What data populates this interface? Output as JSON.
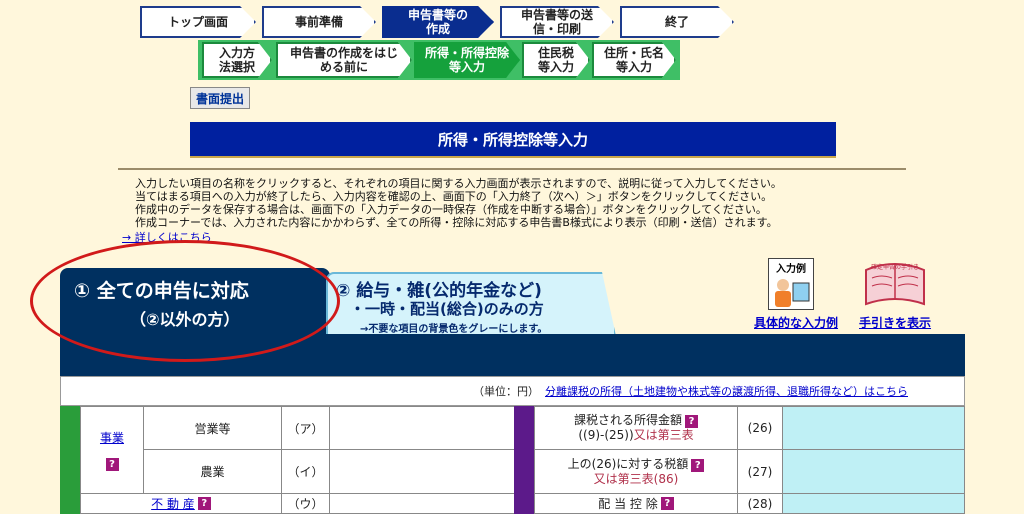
{
  "steps": [
    "トップ画面",
    "事前準備",
    "申告書等の作成",
    "申告書等の送信・印刷",
    "終了"
  ],
  "substeps": [
    "入力方法選択",
    "申告書の作成をはじめる前に",
    "所得・所得控除等入力",
    "住民税等入力",
    "住所・氏名等入力"
  ],
  "submit_button": "書面提出",
  "page_title": "所得・所得控除等入力",
  "instructions": [
    "入力したい項目の名称をクリックすると、それぞれの項目に関する入力画面が表示されますので、説明に従って入力してください。",
    "当てはまる項目への入力が終了したら、入力内容を確認の上、画面下の「入力終了（次へ）＞」ボタンをクリックしてください。",
    "作成中のデータを保存する場合は、画面下の「入力データの一時保存（作成を中断する場合）」ボタンをクリックしてください。",
    "作成コーナーでは、入力された内容にかかわらず、全ての所得・控除に対応する申告書B様式により表示（印刷・送信）されます。"
  ],
  "details_link": "→ 詳しくはこちら",
  "tab1": {
    "line1": "① 全ての申告に対応",
    "line2": "（②以外の方）"
  },
  "tab2": {
    "line1": "② 給与・雑(公的年金など)",
    "line2": "・一時・配当(総合)のみの方",
    "note": "→不要な項目の背景色をグレーにします。"
  },
  "example_icon_label": "入力例",
  "example_link": "具体的な入力例",
  "guide_link": "手引きを表示",
  "guide_icon_text": "確定申告の手引き",
  "unit": "（単位：円）",
  "separate_tax_link": "分離課税の所得（土地建物や株式等の譲渡所得、退職所得など）はこちら",
  "help_mark": "?",
  "left_table": {
    "group_label": "事業",
    "rows": [
      {
        "label": "営業等",
        "code": "（ア）"
      },
      {
        "label": "農業",
        "code": "（イ）"
      }
    ],
    "last_label": "不 動 産",
    "last_code": "（ウ）"
  },
  "right_table": {
    "rows": [
      {
        "label1": "課税される所得金額",
        "label2": "((9)-(25))",
        "label2b": "又は第三表",
        "code": "(26)"
      },
      {
        "label1": "上の(26)に対する税額",
        "label2": "",
        "label2b": "又は第三表(86)",
        "code": "(27)"
      },
      {
        "label1": "配 当 控 除",
        "label2": "",
        "label2b": "",
        "code": "(28)"
      }
    ]
  },
  "colors": {
    "navy": "#003060",
    "accent_blue": "#00209f",
    "green": "#15a13c",
    "red_circle": "#d11a1a",
    "help": "#a0177a"
  }
}
